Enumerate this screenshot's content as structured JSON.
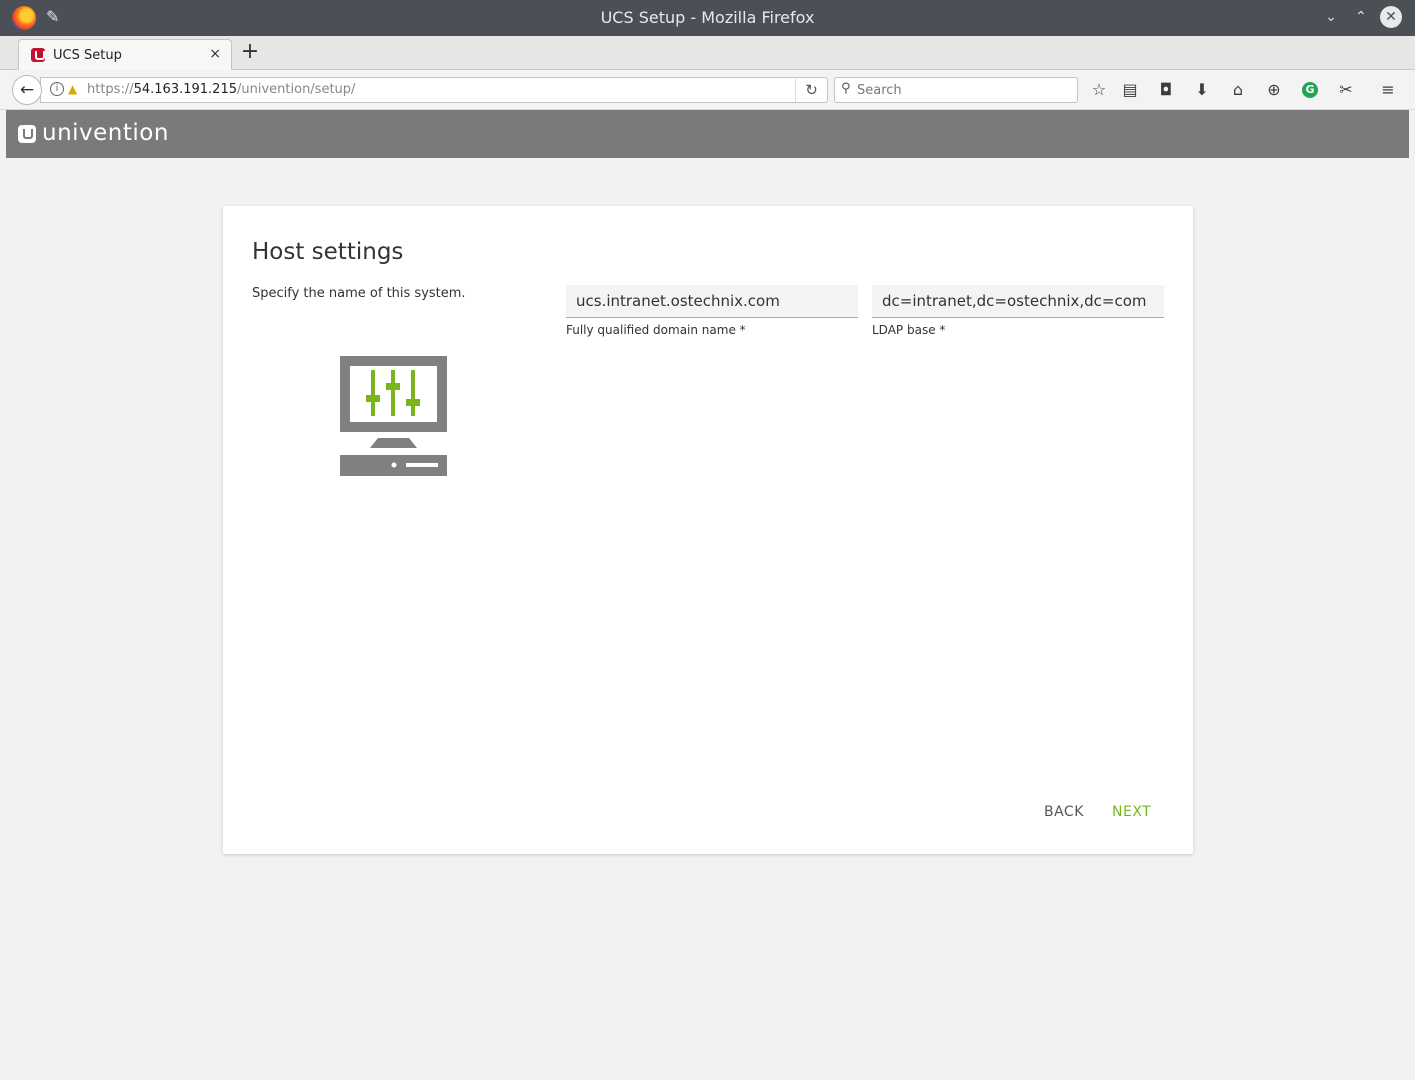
{
  "window": {
    "title": "UCS Setup - Mozilla Firefox",
    "minimize_glyph": "⌄",
    "maximize_glyph": "⌃",
    "close_glyph": "✕"
  },
  "tabs": [
    {
      "label": "UCS Setup",
      "close_glyph": "×"
    }
  ],
  "new_tab_glyph": "+",
  "navbar": {
    "back_glyph": "←",
    "url_scheme": "https://",
    "url_host": "54.163.191.215",
    "url_path": "/univention/setup/",
    "reload_glyph": "↻",
    "search_placeholder": "Search"
  },
  "toolbar_icons": [
    "star-icon",
    "reading-list-icon",
    "pocket-icon",
    "download-icon",
    "home-icon",
    "extension-icon",
    "grammarly-icon",
    "settings-extension-icon",
    "menu-icon"
  ],
  "brand": {
    "name": "univention"
  },
  "page": {
    "title": "Host settings",
    "description": "Specify the name of this system.",
    "fqdn_value": "ucs.intranet.ostechnix.com",
    "fqdn_label": "Fully qualified domain name *",
    "ldap_value": "dc=intranet,dc=ostechnix,dc=com",
    "ldap_label": "LDAP base *",
    "back_label": "BACK",
    "next_label": "NEXT"
  },
  "colors": {
    "accent_green": "#7ab51d",
    "header_gray": "#7a7a7a",
    "titlebar": "#4b4f56",
    "univention_red": "#c1122f"
  }
}
